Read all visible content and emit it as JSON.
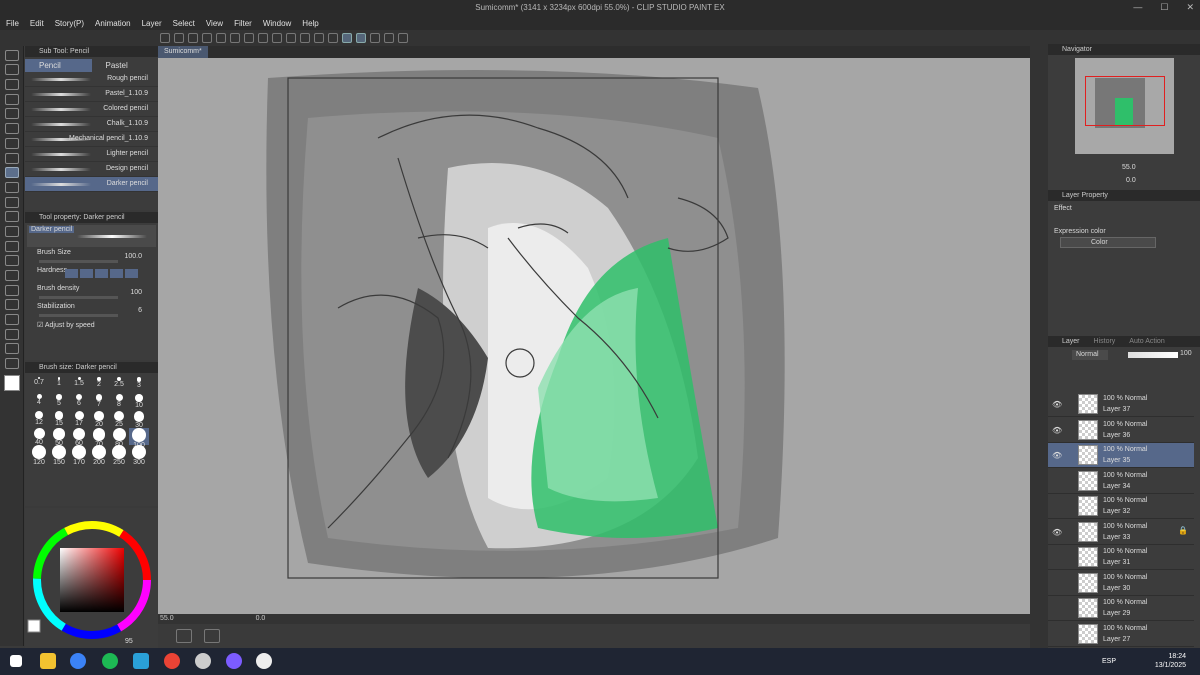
{
  "window": {
    "title": "Sumicomm* (3141 x 3234px 600dpi 55.0%)  - CLIP STUDIO PAINT EX"
  },
  "menu": [
    "File",
    "Edit",
    "Story(P)",
    "Animation",
    "Layer",
    "Select",
    "View",
    "Filter",
    "Window",
    "Help"
  ],
  "subtool": {
    "header": "Sub Tool: Pencil",
    "tabs": [
      "Pencil",
      "Pastel"
    ],
    "items": [
      "Rough pencil",
      "Pastel_1.10.9",
      "Colored pencil",
      "Chalk_1.10.9",
      "Mechanical pencil_1.10.9",
      "Lighter pencil",
      "Design pencil",
      "Darker pencil"
    ]
  },
  "toolprop": {
    "header": "Tool property: Darker pencil",
    "brush_name": "Darker pencil",
    "brush_size_label": "Brush Size",
    "brush_size": "100.0",
    "hardness_label": "Hardness",
    "density_label": "Brush density",
    "density": "100",
    "stabilization_label": "Stabilization",
    "stabilization": "6",
    "adjust_label": "Adjust by speed"
  },
  "brushsize": {
    "header": "Brush size: Darker pencil",
    "sizes": [
      "0.7",
      "1",
      "1.5",
      "2",
      "2.5",
      "3",
      "4",
      "5",
      "6",
      "7",
      "8",
      "10",
      "12",
      "15",
      "17",
      "20",
      "25",
      "30",
      "40",
      "50",
      "60",
      "70",
      "80",
      "100",
      "120",
      "150",
      "170",
      "200",
      "250",
      "300"
    ]
  },
  "colorpanel": {
    "main_color": "#ffffff",
    "opacity_value": "95"
  },
  "canvas": {
    "tab": "Sumicomm*",
    "zoom": "55.0",
    "angle": "0.0"
  },
  "navigator": {
    "header": "Navigator",
    "zoom": "55.0",
    "rotate": "0.0"
  },
  "layerprop": {
    "header": "Layer Property",
    "effect_label": "Effect",
    "expression_label": "Expression color",
    "expression_value": "Color"
  },
  "layerpanel": {
    "tabs": [
      "Layer",
      "History",
      "Auto Action"
    ],
    "blend_mode": "Normal",
    "opacity": "100",
    "layers": [
      {
        "mode": "100 % Normal",
        "name": "Layer 37",
        "visible": true
      },
      {
        "mode": "100 % Normal",
        "name": "Layer 36",
        "visible": true
      },
      {
        "mode": "100 % Normal",
        "name": "Layer 35",
        "visible": true,
        "selected": true
      },
      {
        "mode": "100 % Normal",
        "name": "Layer 34",
        "visible": false
      },
      {
        "mode": "100 % Normal",
        "name": "Layer 32",
        "visible": false
      },
      {
        "mode": "100 % Normal",
        "name": "Layer 33",
        "visible": true,
        "locked": true
      },
      {
        "mode": "100 % Normal",
        "name": "Layer 31",
        "visible": false
      },
      {
        "mode": "100 % Normal",
        "name": "Layer 30",
        "visible": false
      },
      {
        "mode": "100 % Normal",
        "name": "Layer 29",
        "visible": false
      },
      {
        "mode": "100 % Normal",
        "name": "Layer 27",
        "visible": false
      }
    ]
  },
  "taskbar": {
    "time": "18:24",
    "date": "13/1/2025",
    "lang": "ESP"
  },
  "colors": {
    "accent": "#56688a",
    "green_paint": "#2fbf6a"
  }
}
